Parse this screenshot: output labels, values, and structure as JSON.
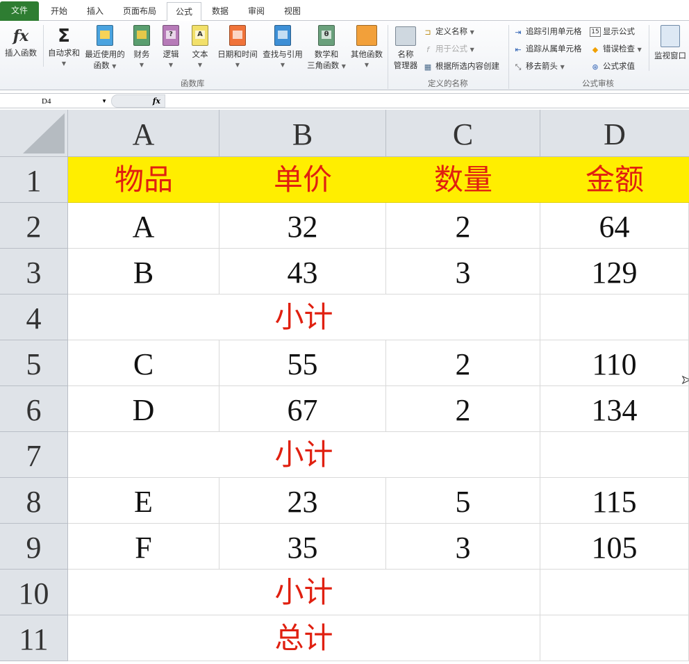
{
  "tabs": [
    {
      "label": "文件"
    },
    {
      "label": "开始"
    },
    {
      "label": "插入"
    },
    {
      "label": "页面布局"
    },
    {
      "label": "公式",
      "active": true
    },
    {
      "label": "数据"
    },
    {
      "label": "审阅"
    },
    {
      "label": "视图"
    }
  ],
  "ribbon": {
    "function_library": {
      "group_label": "函数库",
      "insert_function": "插入函数",
      "autosum": "自动求和",
      "recent_line1": "最近使用的",
      "recent_line2": "函数",
      "financial": "财务",
      "logical": "逻辑",
      "text": "文本",
      "datetime": "日期和时间",
      "lookup": "查找与引用",
      "math_line1": "数学和",
      "math_line2": "三角函数",
      "more": "其他函数"
    },
    "defined_names": {
      "group_label": "定义的名称",
      "name_manager_line1": "名称",
      "name_manager_line2": "管理器",
      "define_name": "定义名称",
      "use_in_formula": "用于公式",
      "create_from_selection": "根据所选内容创建"
    },
    "formula_auditing": {
      "group_label": "公式审核",
      "trace_precedents": "追踪引用单元格",
      "trace_dependents": "追踪从属单元格",
      "remove_arrows": "移去箭头",
      "show_formulas": "显示公式",
      "error_checking": "错误检查",
      "evaluate_formula": "公式求值",
      "watch_window": "监视窗口"
    }
  },
  "formula_bar": {
    "name_box": "D4",
    "fx_label": "fx",
    "formula": ""
  },
  "sheet": {
    "columns": [
      "A",
      "B",
      "C",
      "D"
    ],
    "rows": [
      "1",
      "2",
      "3",
      "4",
      "5",
      "6",
      "7",
      "8",
      "9",
      "10",
      "11"
    ],
    "header": [
      "物品",
      "单价",
      "数量",
      "金额"
    ],
    "data": [
      {
        "item": "A",
        "price": "32",
        "qty": "2",
        "amount": "64"
      },
      {
        "item": "B",
        "price": "43",
        "qty": "3",
        "amount": "129"
      },
      {
        "subtotal": "小计"
      },
      {
        "item": "C",
        "price": "55",
        "qty": "2",
        "amount": "110"
      },
      {
        "item": "D",
        "price": "67",
        "qty": "2",
        "amount": "134"
      },
      {
        "subtotal": "小计"
      },
      {
        "item": "E",
        "price": "23",
        "qty": "5",
        "amount": "115"
      },
      {
        "item": "F",
        "price": "35",
        "qty": "3",
        "amount": "105"
      },
      {
        "subtotal": "小计"
      },
      {
        "subtotal": "总计"
      }
    ]
  },
  "colors": {
    "header_fill": "#ffee00",
    "header_text": "#e02010",
    "file_tab": "#2e7d32"
  }
}
